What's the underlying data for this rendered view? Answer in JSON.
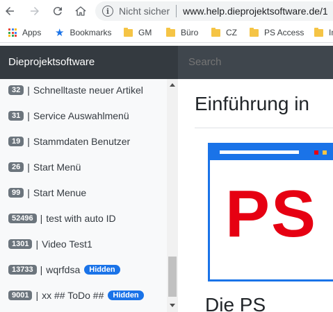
{
  "browser": {
    "security_label": "Nicht sicher",
    "url": "www.help.dieprojektsoftware.de/1",
    "bookmarks": [
      {
        "label": "Apps",
        "icon": "apps-icon"
      },
      {
        "label": "Bookmarks",
        "icon": "star-icon"
      },
      {
        "label": "GM",
        "icon": "folder-icon"
      },
      {
        "label": "Büro",
        "icon": "folder-icon"
      },
      {
        "label": "CZ",
        "icon": "folder-icon"
      },
      {
        "label": "PS Access",
        "icon": "folder-icon"
      },
      {
        "label": "In",
        "icon": "folder-icon"
      }
    ]
  },
  "header": {
    "brand": "Dieprojektsoftware",
    "search_placeholder": "Search"
  },
  "sidebar": {
    "items": [
      {
        "id": "32",
        "label": "Schnelltaste neuer Artikel",
        "hidden": false
      },
      {
        "id": "31",
        "label": "Service Auswahlmenü",
        "hidden": false
      },
      {
        "id": "19",
        "label": "Stammdaten Benutzer",
        "hidden": false
      },
      {
        "id": "26",
        "label": "Start Menü",
        "hidden": false
      },
      {
        "id": "99",
        "label": "Start Menue",
        "hidden": false
      },
      {
        "id": "52496",
        "label": "test with auto ID",
        "hidden": false
      },
      {
        "id": "1301",
        "label": "Video Test1",
        "hidden": false
      },
      {
        "id": "13733",
        "label": "wqrfdsa",
        "hidden": true
      },
      {
        "id": "9001",
        "label": "xx ## ToDo ##",
        "hidden": true
      }
    ],
    "separator": "|",
    "hidden_badge": "Hidden"
  },
  "main": {
    "title": "Einführung in",
    "banner_logo": "PS",
    "section_title": "Die PS"
  },
  "colors": {
    "header_bg": "#343a40",
    "accent_blue": "#1a73e8",
    "logo_red": "#e60012",
    "badge_grey": "#6c757d"
  }
}
